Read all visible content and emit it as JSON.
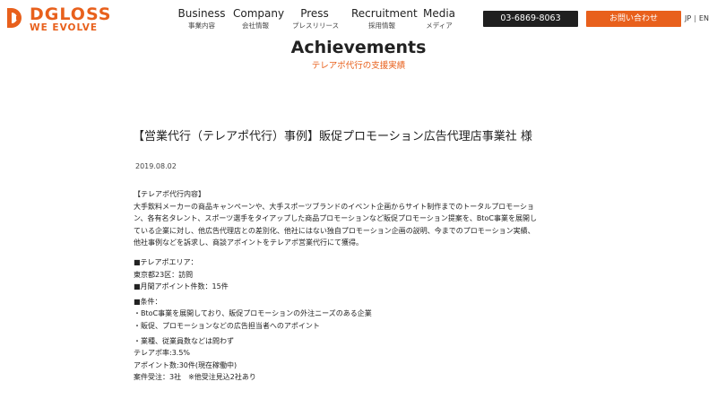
{
  "header": {
    "logo_text": "DGLOSS",
    "logo_tagline": "WE EVOLVE",
    "nav": [
      {
        "en": "Business",
        "ja": "事業内容"
      },
      {
        "en": "Company",
        "ja": "会社情報"
      },
      {
        "en": "Press",
        "ja": "プレスリリース"
      },
      {
        "en": "Recruitment",
        "ja": "採用情報"
      },
      {
        "en": "Media",
        "ja": "メディア"
      }
    ],
    "phone": "03-6869-8063",
    "contact_label": "お問い合わせ",
    "lang_jp": "JP",
    "lang_sep": "|",
    "lang_en": "EN"
  },
  "section": {
    "title": "Achievements",
    "subtitle": "テレアポ代行の支援実績"
  },
  "article": {
    "title": "【営業代行（テレアポ代行）事例】販促プロモーション広告代理店事業社 様",
    "date": "2019.08.02",
    "lines": [
      "【テレアポ代行内容】",
      "大手飲料メーカーの商品キャンペーンや、大手スポーツブランドのイベント企画からサイト制作までのトータルプロモーショ",
      "ン、各有名タレント、スポーツ選手をタイアップした商品プロモーションなど販促プロモーション提案を、BtoC事業を展開し",
      "ている企業に対し、他広告代理店との差別化、他社にはない独自プロモーション企画の説明、今までのプロモーション実績、",
      "他社事例などを訴求し、商談アポイントをテレアポ営業代行にて獲得。",
      "■テレアポエリア：",
      "東京都23区：訪問",
      "■月間アポイント件数：15件",
      "■条件：",
      "・BtoC事業を展開しており、販促プロモーションの外注ニーズのある企業",
      "・販促、プロモーションなどの広告担当者へのアポイント",
      "・業種、従業員数などは問わず",
      "テレアポ率:3.5%",
      "アポイント数:30件(現在稼働中)",
      "案件受注：3社　※他受注見込2社あり"
    ]
  },
  "colors": {
    "brand": "#e8601c",
    "phone_bg": "#1f1f1f",
    "text": "#222222"
  },
  "icons": {
    "logo_mark": "dgloss-logo-icon"
  }
}
